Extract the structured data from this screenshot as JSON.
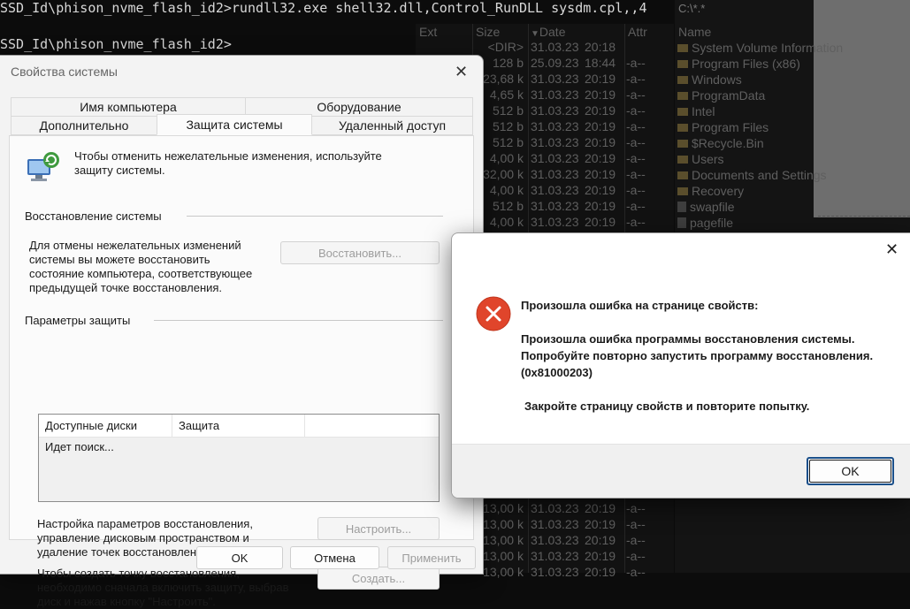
{
  "terminal": {
    "line1": "SSD_Id\\phison_nvme_flash_id2>rundll32.exe shell32.dll,Control_RunDLL sysdm.cpl,,4",
    "line2": "SSD_Id\\phison_nvme_flash_id2>"
  },
  "file_manager": {
    "left_headers": {
      "ext": "Ext",
      "size": "Size",
      "date": "Date",
      "attr": "Attr"
    },
    "right_path": "C:\\*.*",
    "right_header": "Name",
    "rows_top": [
      {
        "size": "<DIR>",
        "date": "31.03.23",
        "time": "20:18",
        "attr": ""
      },
      {
        "size": "128 b",
        "date": "25.09.23",
        "time": "18:44",
        "attr": "-a--"
      },
      {
        "size": "23,68 k",
        "date": "31.03.23",
        "time": "20:19",
        "attr": "-a--"
      },
      {
        "size": "4,65 k",
        "date": "31.03.23",
        "time": "20:19",
        "attr": "-a--"
      },
      {
        "size": "512 b",
        "date": "31.03.23",
        "time": "20:19",
        "attr": "-a--"
      },
      {
        "size": "512 b",
        "date": "31.03.23",
        "time": "20:19",
        "attr": "-a--"
      },
      {
        "size": "512 b",
        "date": "31.03.23",
        "time": "20:19",
        "attr": "-a--"
      },
      {
        "size": "4,00 k",
        "date": "31.03.23",
        "time": "20:19",
        "attr": "-a--"
      },
      {
        "size": "32,00 k",
        "date": "31.03.23",
        "time": "20:19",
        "attr": "-a--"
      },
      {
        "size": "4,00 k",
        "date": "31.03.23",
        "time": "20:19",
        "attr": "-a--"
      },
      {
        "size": "512 b",
        "date": "31.03.23",
        "time": "20:19",
        "attr": "-a--"
      },
      {
        "size": "4,00 k",
        "date": "31.03.23",
        "time": "20:19",
        "attr": "-a--"
      }
    ],
    "rows_bottom": [
      {
        "size": "13,00 k",
        "date": "31.03.23",
        "time": "20:19",
        "attr": "-a--"
      },
      {
        "size": "13,00 k",
        "date": "31.03.23",
        "time": "20:19",
        "attr": "-a--"
      },
      {
        "size": "13,00 k",
        "date": "31.03.23",
        "time": "20:19",
        "attr": "-a--"
      },
      {
        "size": "13,00 k",
        "date": "31.03.23",
        "time": "20:19",
        "attr": "-a--"
      },
      {
        "size": "13,00 k",
        "date": "31.03.23",
        "time": "20:19",
        "attr": "-a--"
      }
    ],
    "right_items": [
      {
        "name": "System Volume Information",
        "kind": "folder"
      },
      {
        "name": "Program Files (x86)",
        "kind": "folder"
      },
      {
        "name": "Windows",
        "kind": "folder"
      },
      {
        "name": "ProgramData",
        "kind": "folder"
      },
      {
        "name": "Intel",
        "kind": "folder"
      },
      {
        "name": "Program Files",
        "kind": "folder"
      },
      {
        "name": "$Recycle.Bin",
        "kind": "folder"
      },
      {
        "name": "Users",
        "kind": "folder"
      },
      {
        "name": "Documents and Settings",
        "kind": "folder"
      },
      {
        "name": "Recovery",
        "kind": "folder"
      },
      {
        "name": "swapfile",
        "kind": "file"
      },
      {
        "name": "pagefile",
        "kind": "file"
      }
    ]
  },
  "system_properties": {
    "title": "Свойства системы",
    "tabs_row1": [
      "Имя компьютера",
      "Оборудование"
    ],
    "tabs_row2": [
      "Дополнительно",
      "Защита системы",
      "Удаленный доступ"
    ],
    "active_tab": "Защита системы",
    "intro": "Чтобы отменить нежелательные изменения, используйте защиту системы.",
    "intro_line1": "Чтобы отменить нежелательные изменения, используйте",
    "intro_line2": "защиту системы.",
    "restore_section": "Восстановление системы",
    "restore_desc": [
      "Для отмены нежелательных изменений",
      "системы вы можете восстановить",
      "состояние компьютера, соответствующее",
      "предыдущей точке восстановления."
    ],
    "restore_button": "Восстановить...",
    "protection_section": "Параметры защиты",
    "list_headers": [
      "Доступные диски",
      "Защита"
    ],
    "list_status": "Идет поиск...",
    "configure_desc": [
      "Настройка параметров восстановления,",
      "управление дисковым пространством и",
      "удаление точек восстановления."
    ],
    "configure_button": "Настроить...",
    "create_desc": [
      "Чтобы создать точку восстановления,",
      "необходимо сначала включить защиту, выбрав",
      "диск и нажав кнопку \"Настроить\"."
    ],
    "create_button": "Создать...",
    "ok_button": "OK",
    "cancel_button": "Отмена",
    "apply_button": "Применить"
  },
  "error_dialog": {
    "heading": "Произошла ошибка на странице свойств:",
    "message_lines": [
      "Произошла ошибка программы восстановления системы.",
      "Попробуйте повторно запустить программу восстановления.",
      "(0x81000203)"
    ],
    "footer_message": "Закройте страницу свойств и повторите попытку.",
    "ok_button": "OK",
    "icon": "error-icon"
  },
  "colors": {
    "error_red": "#e0452b",
    "accent_blue": "#1a4f8a"
  }
}
